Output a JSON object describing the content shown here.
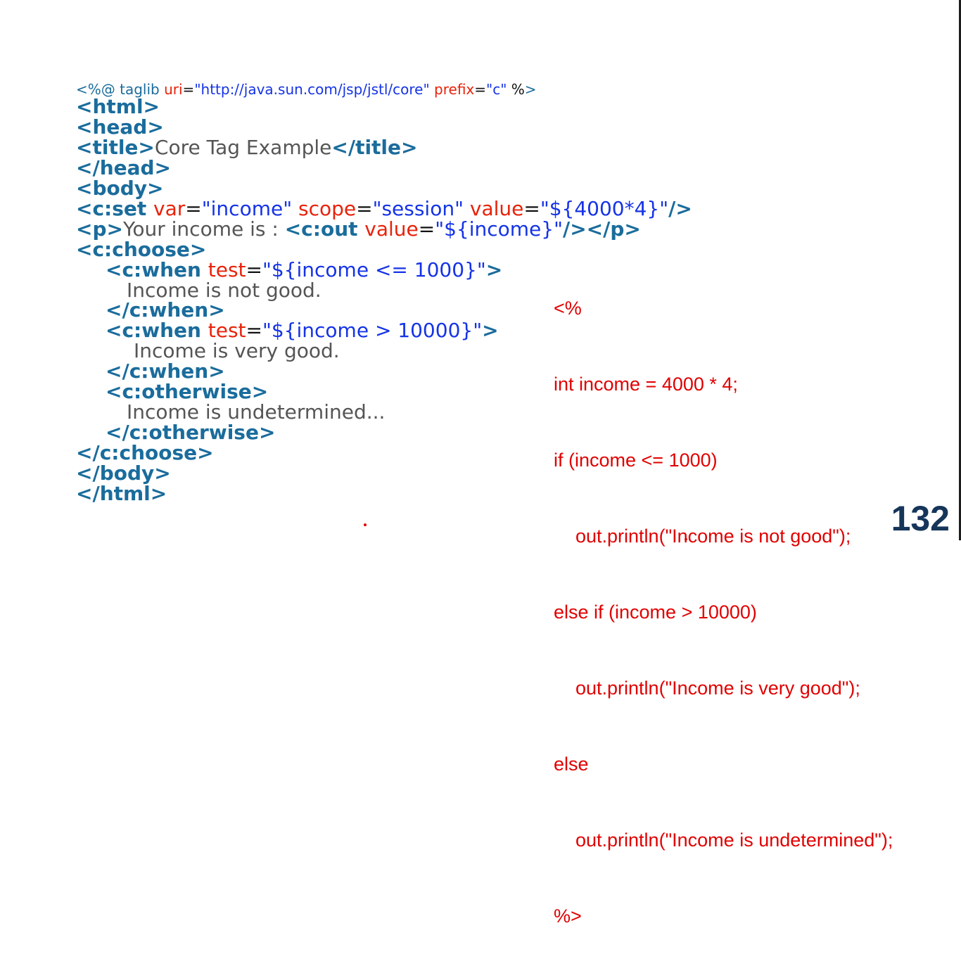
{
  "code": {
    "taglib": {
      "open": "<%@ taglib ",
      "attr1": "uri",
      "eq1": "=",
      "val1": "\"http://java.sun.com/jsp/jstl/core\"",
      "attr2": " prefix",
      "eq2": "=",
      "val2": "\"c\"",
      "close_text": " %",
      "close_mark": ">"
    },
    "html_open": "<html>",
    "head_open": "<head>",
    "title_open": "<title>",
    "title_text": "Core Tag Example",
    "title_close": "</title>",
    "head_close": "</head>",
    "body_open": "<body>",
    "set": {
      "tag": "<c:set ",
      "a1": "var",
      "v1": "\"income\"",
      "a2": " scope",
      "v2": "\"session\"",
      "a3": " value",
      "v3": "\"${4000*4}\"",
      "end": "/>"
    },
    "para": {
      "p_open": "<p>",
      "text": "Your income is : ",
      "out_tag": "<c:out ",
      "attr": "value",
      "val": "\"${income}\"",
      "end": "/></p>"
    },
    "choose_open": "<c:choose>",
    "when1": {
      "tag": "<c:when ",
      "attr": "test",
      "val": "\"${income <= 1000}\"",
      "end": ">"
    },
    "when1_text": "Income is not good.",
    "when_close": "</c:when>",
    "when2": {
      "tag": "<c:when ",
      "attr": "test",
      "val": "\"${income > 10000}\"",
      "end": ">"
    },
    "when2_text": "Income is very good.",
    "otherwise_open": "<c:otherwise>",
    "otherwise_text": "Income is undetermined...",
    "otherwise_close": "</c:otherwise>",
    "choose_close": "</c:choose>",
    "body_close": "</body>",
    "html_close": "</html>",
    "equals": "="
  },
  "java": [
    "<%",
    "int income = 4000 * 4;",
    "if (income <= 1000)",
    "  out.println(\"Income is not good\");",
    "else if (income > 10000)",
    "  out.println(\"Income is very good\");",
    "else",
    "  out.println(\"Income is undetermined\");",
    "%>"
  ],
  "page_number": "132",
  "colors": {
    "tag": "#1a6c9c",
    "attribute": "#e8220a",
    "value": "#1533e6",
    "text": "#555555",
    "java": "#e10000",
    "page_number": "#16355a"
  }
}
